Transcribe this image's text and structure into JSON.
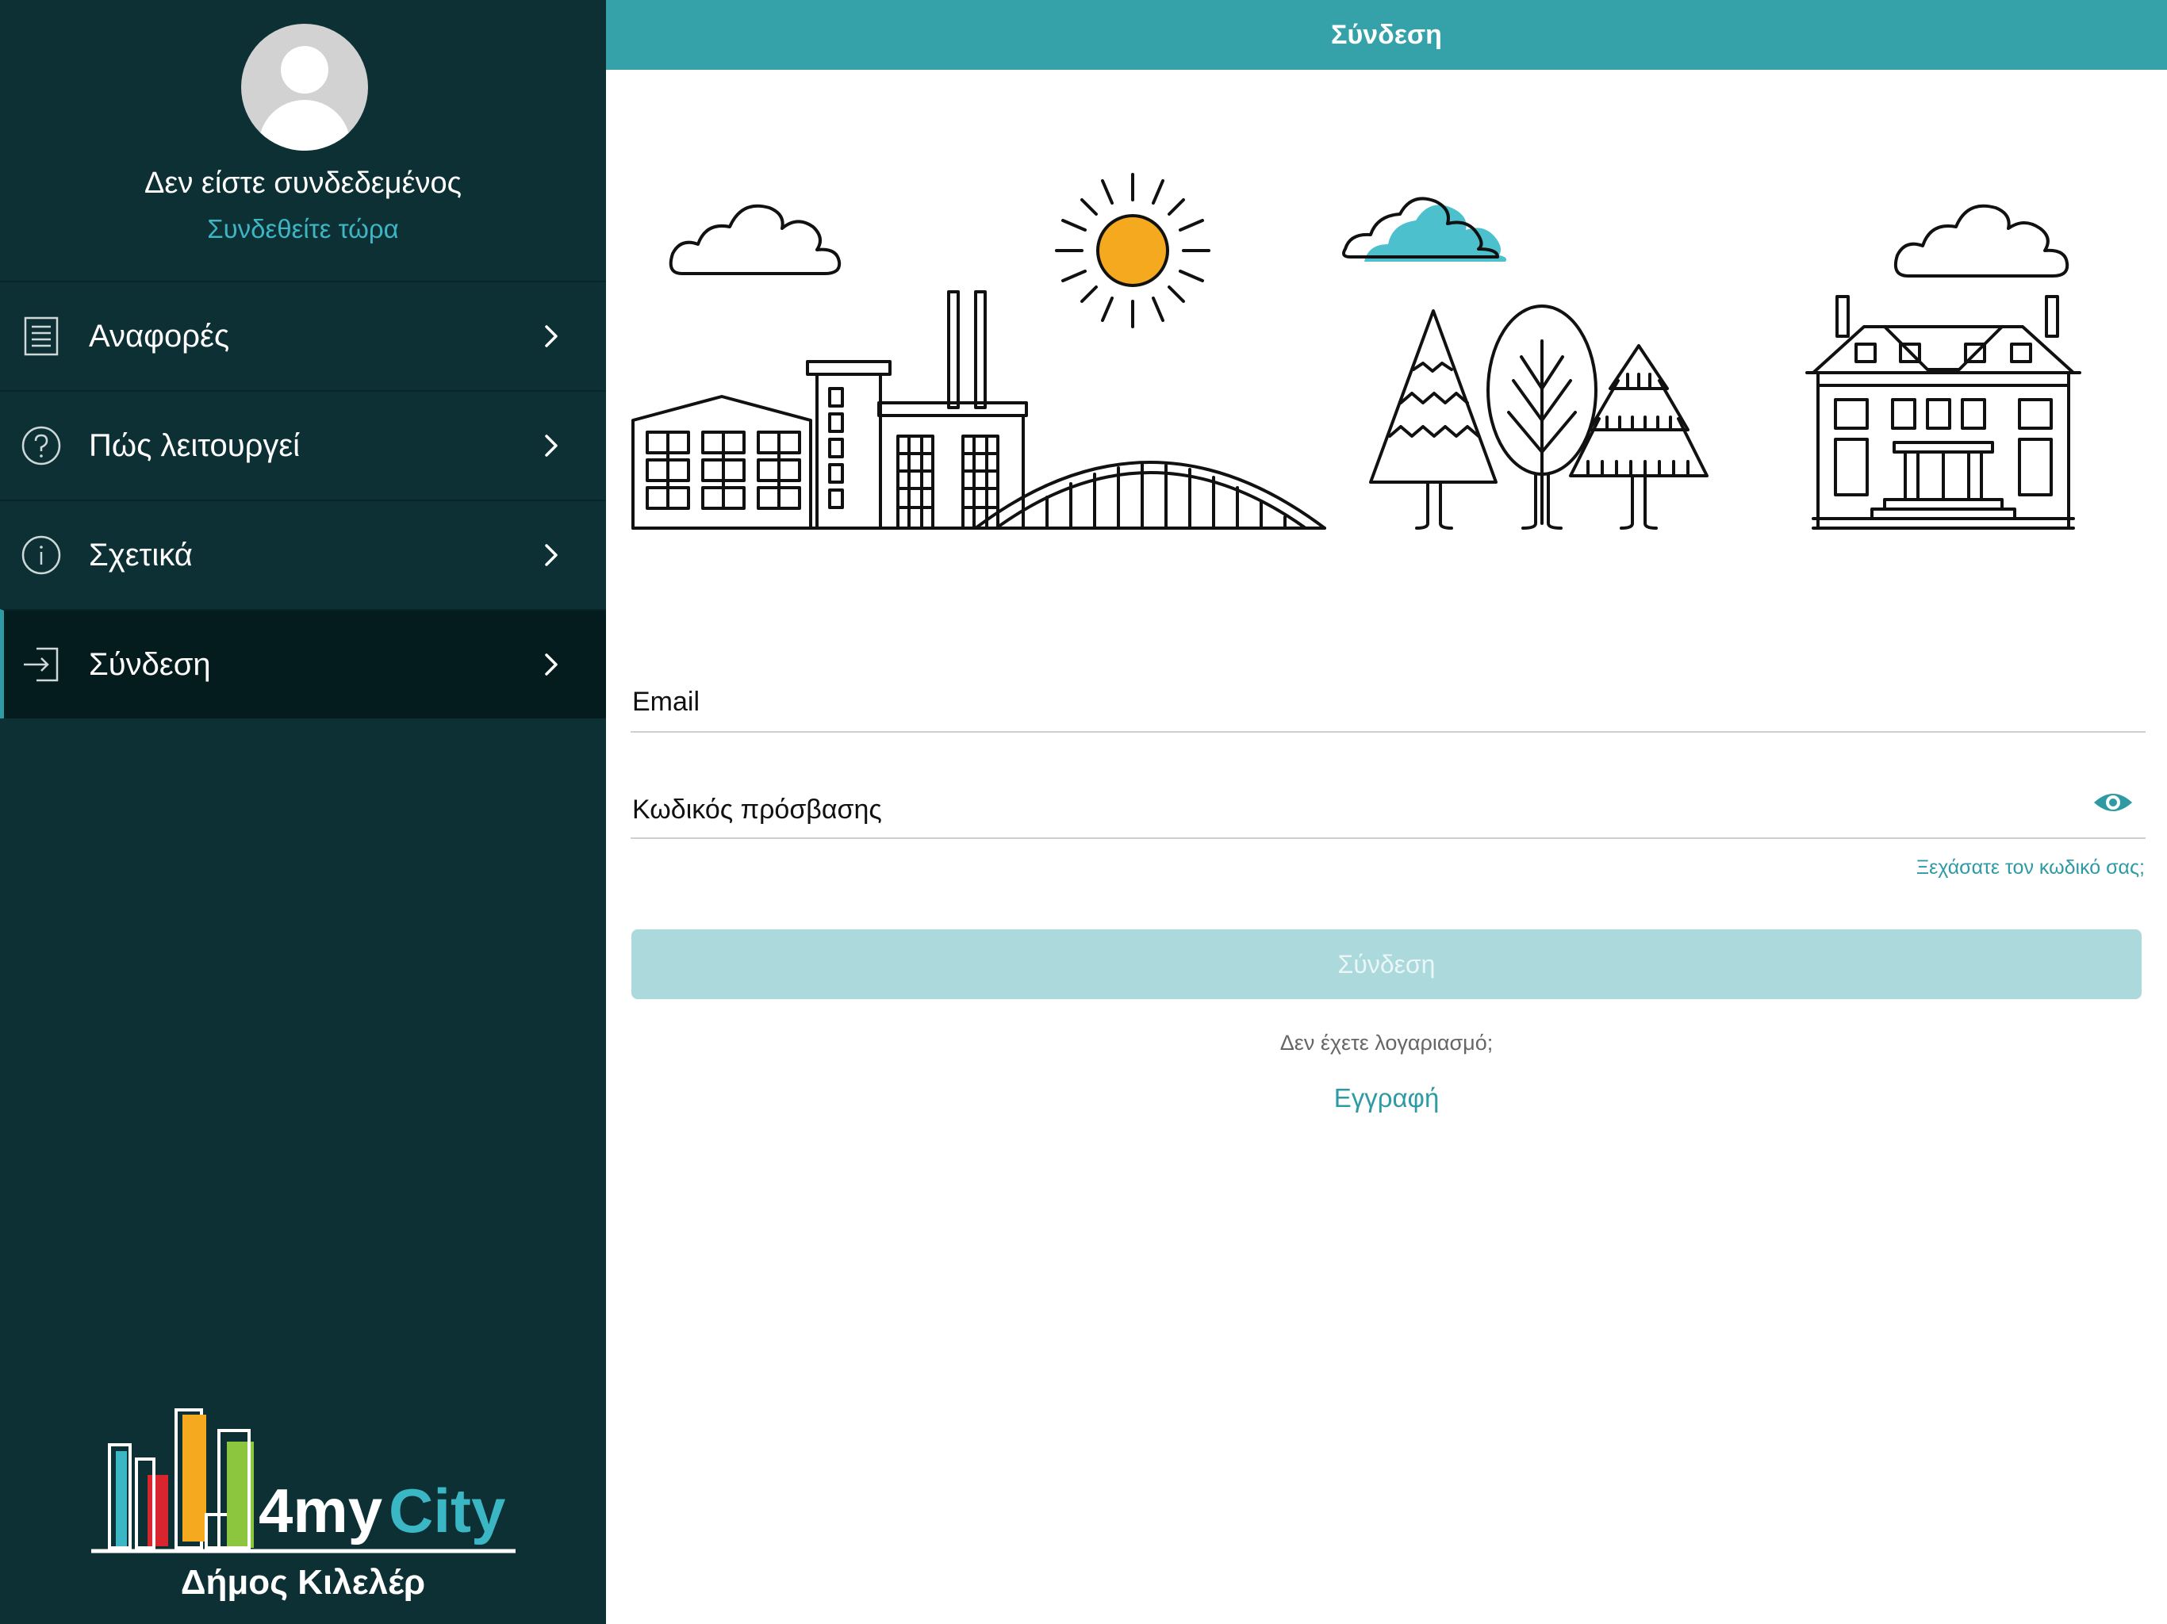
{
  "header": {
    "title": "Σύνδεση"
  },
  "sidebar": {
    "user_status": "Δεν είστε συνδεδεμένος",
    "login_link": "Συνδεθείτε τώρα",
    "items": [
      {
        "label": "Αναφορές",
        "icon": "document-icon",
        "active": false
      },
      {
        "label": "Πώς λειτουργεί",
        "icon": "question-circle-icon",
        "active": false
      },
      {
        "label": "Σχετικά",
        "icon": "info-circle-icon",
        "active": false
      },
      {
        "label": "Σύνδεση",
        "icon": "login-arrow-icon",
        "active": true
      }
    ],
    "logo": {
      "brand_prefix": "4my",
      "brand_suffix": "City",
      "municipality": "Δήμος Κιλελέρ"
    }
  },
  "form": {
    "email_label": "Email",
    "password_label": "Κωδικός πρόσβασης",
    "forgot_password": "Ξεχάσατε τον κωδικό σας;",
    "login_button": "Σύνδεση",
    "no_account": "Δεν έχετε λογαριασμό;",
    "register_link": "Εγγραφή"
  },
  "colors": {
    "sidebar_bg": "#0c3034",
    "header_bg": "#35a2a9",
    "accent": "#2e9aa4",
    "button_disabled": "#abd9dc",
    "sun": "#f5a91e",
    "cloud_teal": "#4cc0cc"
  }
}
